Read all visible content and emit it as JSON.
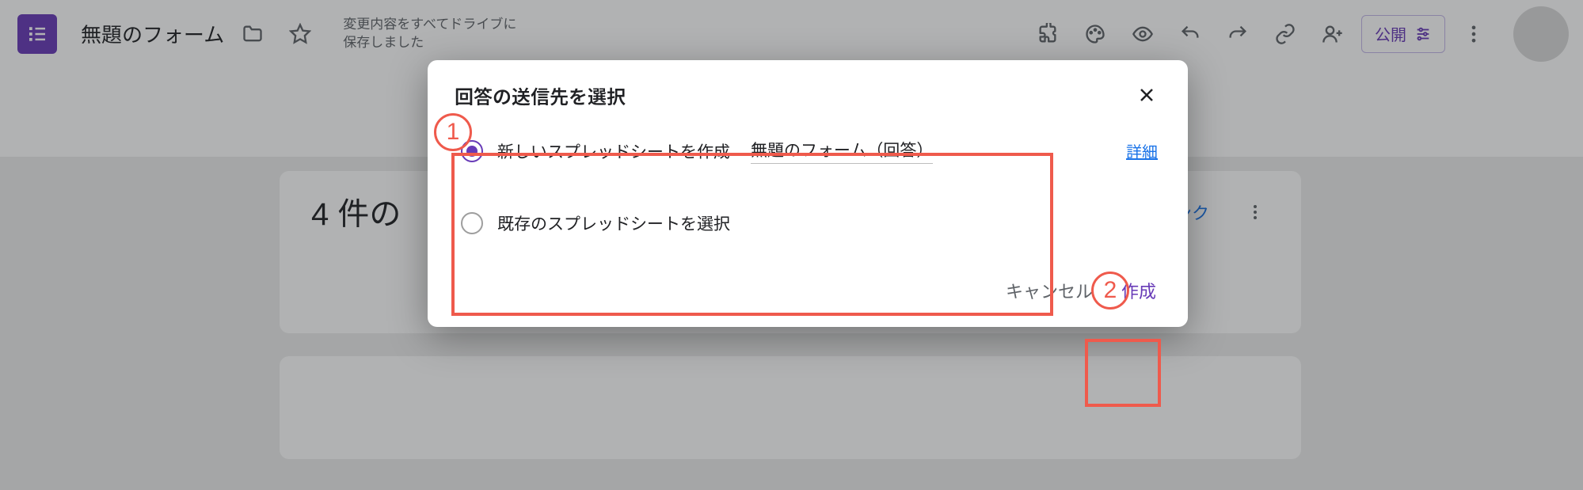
{
  "header": {
    "form_title": "無題のフォーム",
    "save_status_line1": "変更内容をすべてドライブに",
    "save_status_line2": "保存しました",
    "publish_label": "公開"
  },
  "body": {
    "responses_prefix": "4 件の",
    "link_partial": "ンク"
  },
  "dialog": {
    "title": "回答の送信先を選択",
    "option_new": "新しいスプレッドシートを作成",
    "new_sheet_name": "無題のフォーム（回答）",
    "detail_link": "詳細",
    "option_existing": "既存のスプレッドシートを選択",
    "cancel": "キャンセル",
    "create": "作成"
  },
  "annotations": {
    "one": "1",
    "two": "2"
  }
}
